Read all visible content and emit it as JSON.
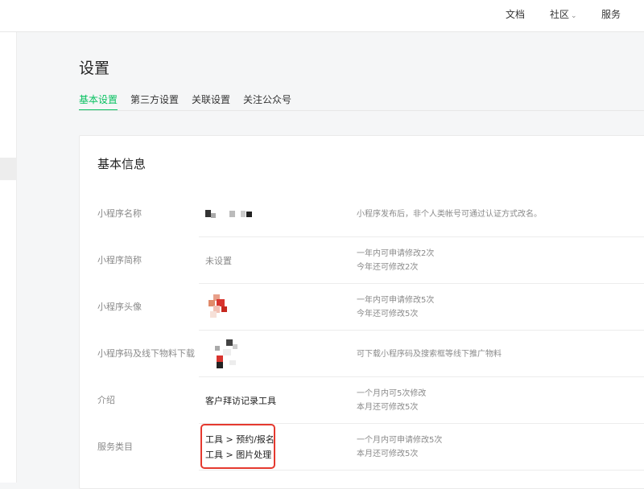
{
  "topnav": {
    "docs": "文档",
    "community": "社区",
    "services": "服务"
  },
  "page": {
    "title": "设置",
    "tabs": [
      {
        "label": "基本设置",
        "active": true
      },
      {
        "label": "第三方设置",
        "active": false
      },
      {
        "label": "关联设置",
        "active": false
      },
      {
        "label": "关注公众号",
        "active": false
      }
    ]
  },
  "card": {
    "title": "基本信息",
    "rows": [
      {
        "label": "小程序名称",
        "value": [],
        "desc": [
          "小程序发布后，非个人类帐号可通过认证方式改名。"
        ]
      },
      {
        "label": "小程序简称",
        "value": [
          "未设置"
        ],
        "desc": [
          "一年内可申请修改2次",
          "今年还可修改2次"
        ]
      },
      {
        "label": "小程序头像",
        "value": [],
        "desc": [
          "一年内可申请修改5次",
          "今年还可修改5次"
        ]
      },
      {
        "label": "小程序码及线下物料下载",
        "value": [],
        "desc": [
          "可下载小程序码及搜索框等线下推广物料"
        ]
      },
      {
        "label": "介绍",
        "value": [
          "客户拜访记录工具"
        ],
        "desc": [
          "一个月内可5次修改",
          "本月还可修改5次"
        ]
      },
      {
        "label": "服务类目",
        "value": [
          "工具 > 预约/报名",
          "工具 > 图片处理"
        ],
        "desc": [
          "一个月内可申请修改5次",
          "本月还可修改5次"
        ]
      }
    ]
  },
  "colors": {
    "accent": "#07c160",
    "highlight": "#e5392f"
  },
  "icons": {
    "chevron": "chevron-down-icon"
  }
}
